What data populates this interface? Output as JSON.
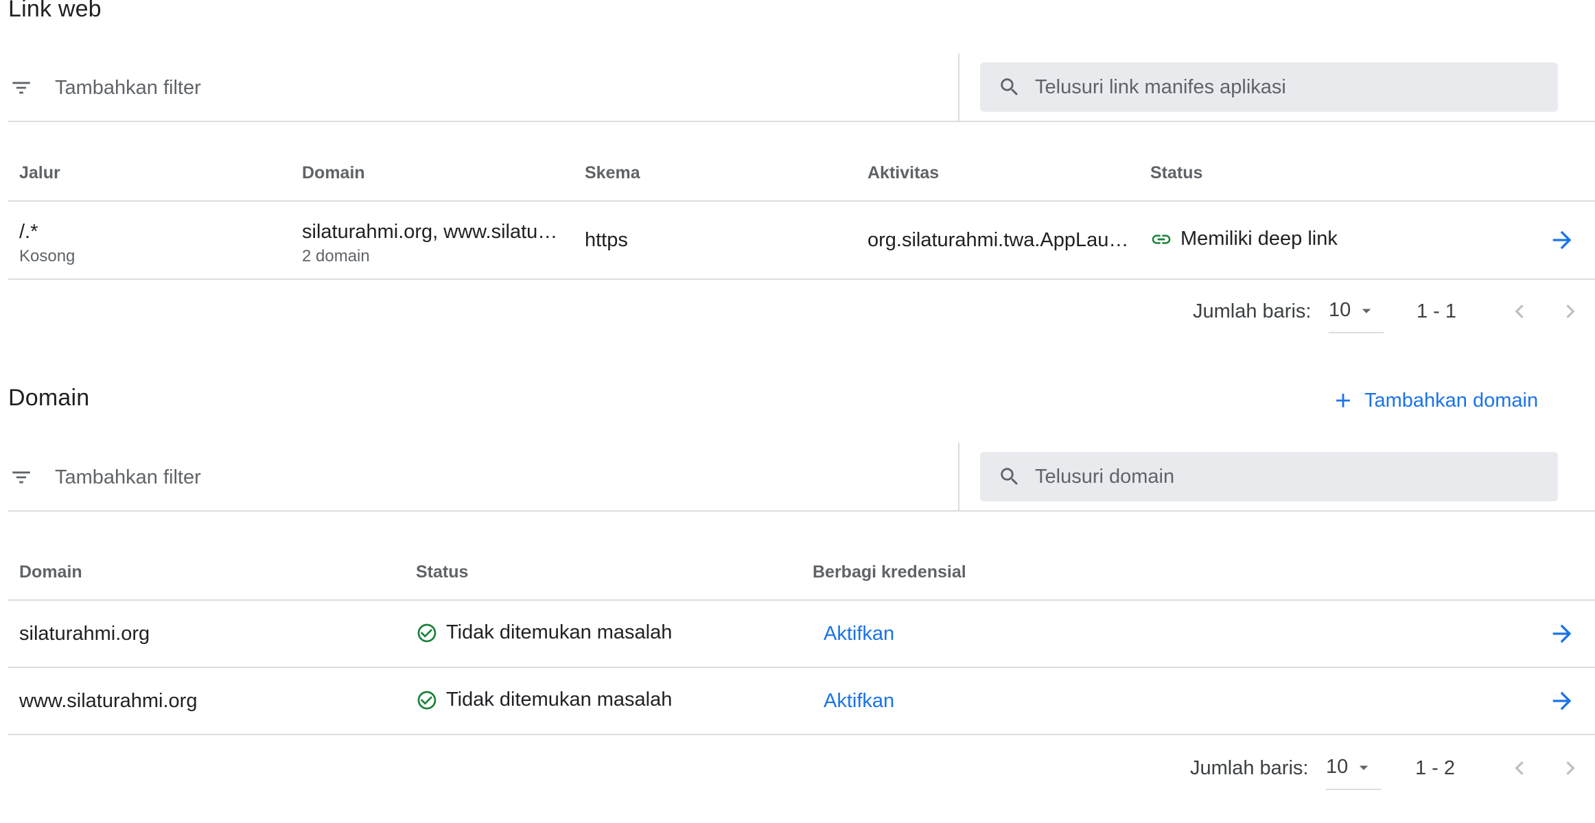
{
  "colors": {
    "accent": "#1a73e8",
    "success": "#188038",
    "border": "#dadce0",
    "search_bg": "#e8eaed"
  },
  "weblinks": {
    "title": "Link web",
    "filter": {
      "icon": "filter-icon",
      "placeholder": "Tambahkan filter"
    },
    "search": {
      "icon": "search-icon",
      "placeholder": "Telusuri link manifes aplikasi"
    },
    "columns": [
      "Jalur",
      "Domain",
      "Skema",
      "Aktivitas",
      "Status"
    ],
    "rows": [
      {
        "path": "/.*",
        "path_sub": "Kosong",
        "domain": "silaturahmi.org, www.silaturahmi.org",
        "domain_sub": "2 domain",
        "scheme": "https",
        "activity": "org.silaturahmi.twa.AppLauncherActivity",
        "status": "Memiliki deep link",
        "status_icon": "link-icon"
      }
    ],
    "pagination": {
      "rows_label": "Jumlah baris:",
      "rows_value": "10",
      "range": "1 - 1"
    }
  },
  "domains": {
    "title": "Domain",
    "add_button": "Tambahkan domain",
    "filter": {
      "icon": "filter-icon",
      "placeholder": "Tambahkan filter"
    },
    "search": {
      "icon": "search-icon",
      "placeholder": "Telusuri domain"
    },
    "columns": [
      "Domain",
      "Status",
      "Berbagi kredensial"
    ],
    "rows": [
      {
        "domain": "silaturahmi.org",
        "status": "Tidak ditemukan masalah",
        "status_icon": "check-circle-icon",
        "action": "Aktifkan"
      },
      {
        "domain": "www.silaturahmi.org",
        "status": "Tidak ditemukan masalah",
        "status_icon": "check-circle-icon",
        "action": "Aktifkan"
      }
    ],
    "pagination": {
      "rows_label": "Jumlah baris:",
      "rows_value": "10",
      "range": "1 - 2"
    }
  }
}
